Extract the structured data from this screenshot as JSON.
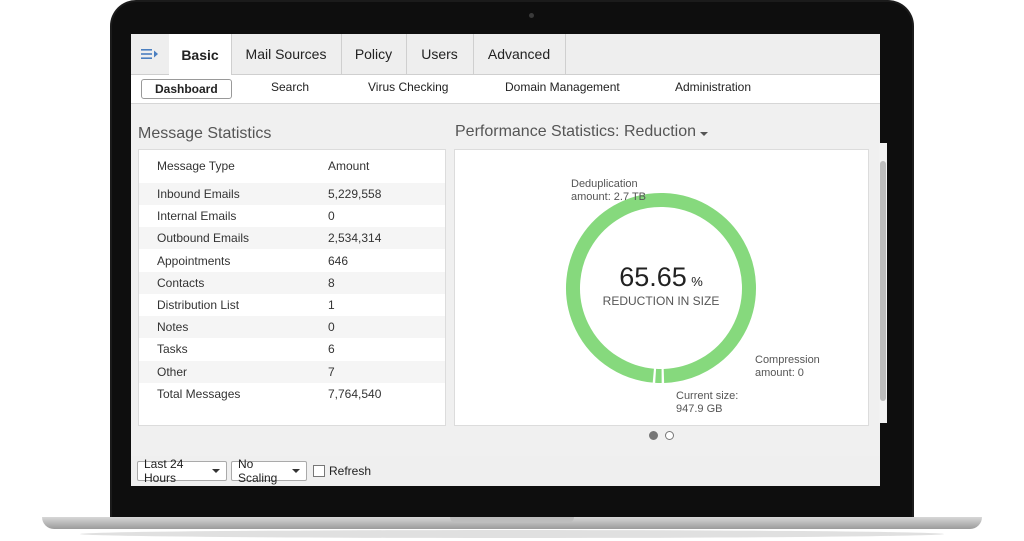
{
  "nav": {
    "tabs": [
      {
        "label": "Basic",
        "active": true
      },
      {
        "label": "Mail Sources"
      },
      {
        "label": "Policy"
      },
      {
        "label": "Users"
      },
      {
        "label": "Advanced"
      }
    ],
    "menu_icon": "menu-arrow-icon"
  },
  "subnav": {
    "items": [
      "Dashboard",
      "Search",
      "Virus Checking",
      "Domain Management",
      "Administration"
    ]
  },
  "message_stats": {
    "title": "Message Statistics",
    "header": [
      "Message Type",
      "Amount"
    ],
    "rows": [
      {
        "type": "Inbound Emails",
        "amount": "5,229,558"
      },
      {
        "type": "Internal Emails",
        "amount": "0"
      },
      {
        "type": "Outbound Emails",
        "amount": "2,534,314"
      },
      {
        "type": "Appointments",
        "amount": "646"
      },
      {
        "type": "Contacts",
        "amount": "8"
      },
      {
        "type": "Distribution List",
        "amount": "1"
      },
      {
        "type": "Notes",
        "amount": "0"
      },
      {
        "type": "Tasks",
        "amount": "6"
      },
      {
        "type": "Other",
        "amount": "7"
      },
      {
        "type": "Total Messages",
        "amount": "7,764,540"
      }
    ]
  },
  "performance": {
    "title": "Performance Statistics: Reduction",
    "value": "65.65",
    "unit": "%",
    "caption": "REDUCTION IN SIZE",
    "dedup_label": "Deduplication",
    "dedup_amount": "amount: 2.7 TB",
    "compression_label": "Compression",
    "compression_amount": "amount: 0",
    "current_label": "Current size:",
    "current_value": "947.9 GB",
    "ring_color": "#86d97d",
    "segments": [
      {
        "name": "Deduplication",
        "fraction": 0.985
      },
      {
        "name": "Current size",
        "fraction": 0.015
      }
    ]
  },
  "pager": {
    "count": 2,
    "active": 0
  },
  "footer": {
    "time_range": "Last 24 Hours",
    "scaling": "No Scaling",
    "refresh_label": "Refresh"
  }
}
